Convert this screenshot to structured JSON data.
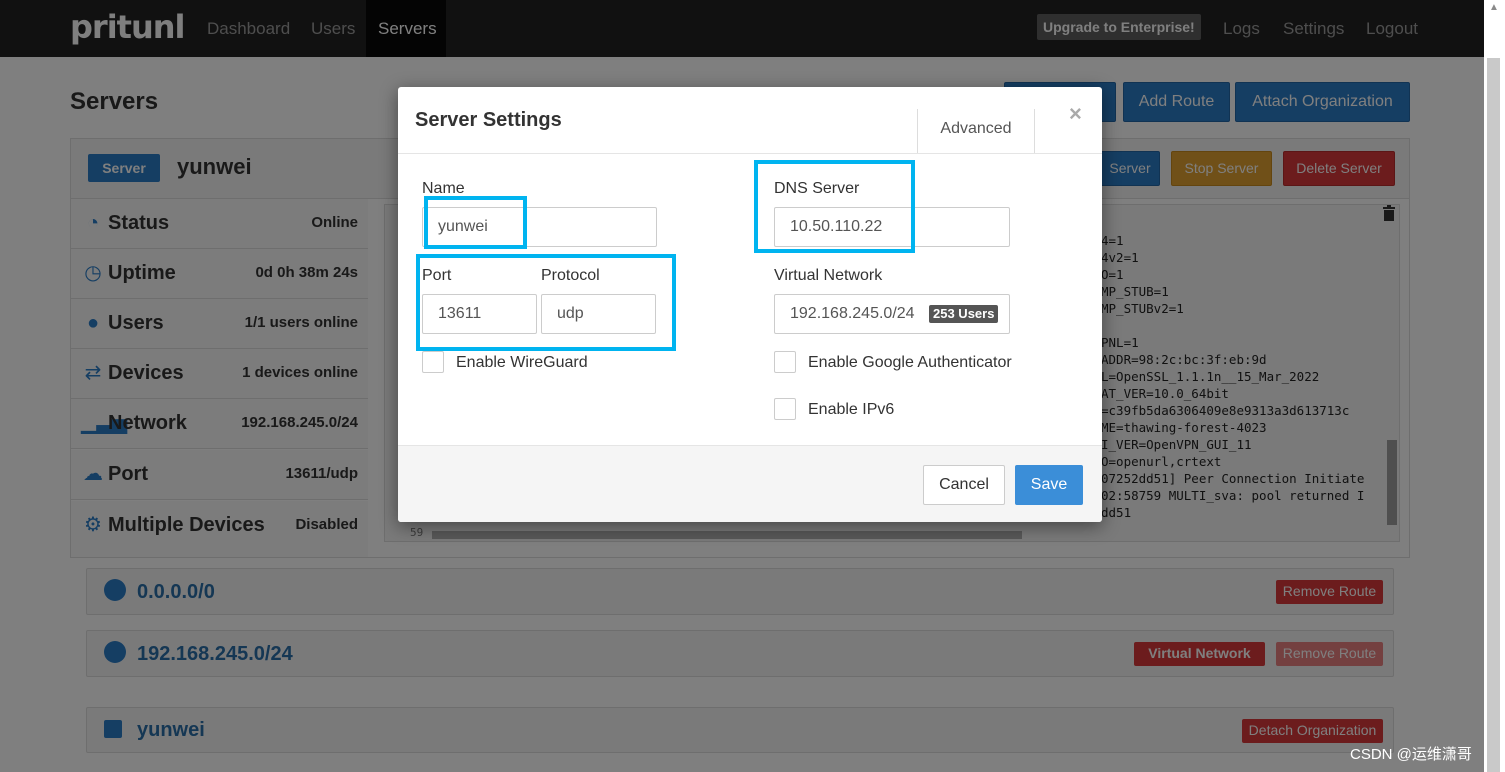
{
  "nav": {
    "brand": "pritunl",
    "links": [
      "Dashboard",
      "Users",
      "Servers"
    ],
    "upgrade": "Upgrade to Enterprise!",
    "right_links": [
      "Logs",
      "Settings",
      "Logout"
    ]
  },
  "page": {
    "title": "Servers",
    "header_buttons": [
      "Add Route",
      "Attach Organization"
    ]
  },
  "server": {
    "badge": "Server",
    "name": "yunwei",
    "actions": [
      "Server",
      "Stop Server",
      "Delete Server"
    ],
    "stats": [
      {
        "label": "Status",
        "value": "Online",
        "icon": "dashboard-icon"
      },
      {
        "label": "Uptime",
        "value": "0d 0h 38m 24s",
        "icon": "clock-icon"
      },
      {
        "label": "Users",
        "value": "1/1 users online",
        "icon": "user-icon"
      },
      {
        "label": "Devices",
        "value": "1 devices online",
        "icon": "swap-icon"
      },
      {
        "label": "Network",
        "value": "192.168.245.0/24",
        "icon": "signal-icon"
      },
      {
        "label": "Port",
        "value": "13611/udp",
        "icon": "cloud-icon"
      },
      {
        "label": "Multiple Devices",
        "value": "Disabled",
        "icon": "gear-icon"
      }
    ],
    "log_lines": [
      "4=1",
      "4v2=1",
      "O=1",
      "MP_STUB=1",
      "MP_STUBv2=1",
      "",
      "PNL=1",
      "ADDR=98:2c:bc:3f:eb:9d",
      "L=OpenSSL_1.1.1n__15_Mar_2022",
      "AT_VER=10.0_64bit",
      "=c39fb5da6306409e8e9313a3d613713c",
      "ME=thawing-forest-4023",
      "I_VER=OpenVPN_GUI_11",
      "O=openurl,crtext",
      "07252dd51] Peer Connection Initiate",
      "02:58759 MULTI_sva: pool returned I",
      "dd51"
    ],
    "log_line_number": "59"
  },
  "routes": [
    {
      "label": "0.0.0.0/0",
      "buttons": [
        "Remove Route"
      ]
    },
    {
      "label": "192.168.245.0/24",
      "buttons": [
        "Virtual Network",
        "Remove Route"
      ]
    }
  ],
  "organization": {
    "label": "yunwei",
    "button": "Detach Organization"
  },
  "modal": {
    "title": "Server Settings",
    "tab": "Advanced",
    "close": "×",
    "name_label": "Name",
    "name_value": "yunwei",
    "dns_label": "DNS Server",
    "dns_value": "10.50.110.22",
    "port_label": "Port",
    "port_value": "13611",
    "protocol_label": "Protocol",
    "protocol_value": "udp",
    "vnet_label": "Virtual Network",
    "vnet_value": "192.168.245.0/24",
    "vnet_badge": "253 Users",
    "wireguard_label": "Enable WireGuard",
    "google_auth_label": "Enable Google Authenticator",
    "ipv6_label": "Enable IPv6",
    "cancel": "Cancel",
    "save": "Save"
  },
  "watermark": "CSDN @运维潇哥",
  "colors": {
    "primary": "#2a7cc7",
    "danger": "#d9393a",
    "warning": "#e0a030",
    "highlight": "#00b4f0"
  }
}
